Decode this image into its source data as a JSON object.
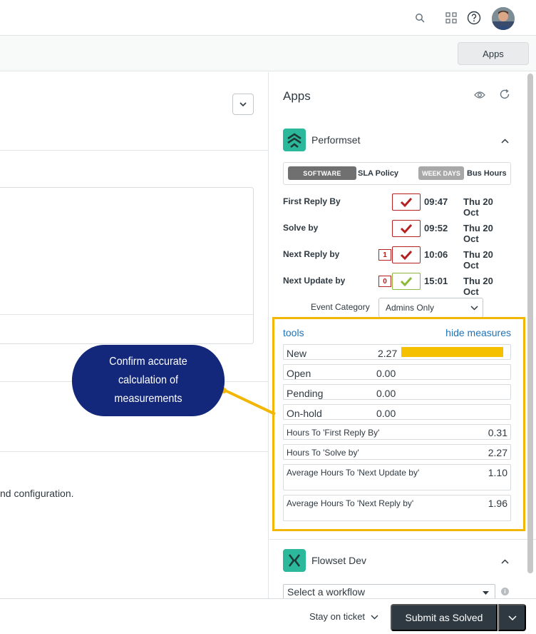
{
  "topbar": {
    "icons": [
      "search-icon",
      "apps-grid-icon",
      "help-icon"
    ],
    "user": "avatar"
  },
  "subbar": {
    "apps_button": "Apps"
  },
  "left": {
    "body_text": "nd configuration."
  },
  "apps_panel": {
    "title": "Apps",
    "icons": [
      "eye-icon",
      "refresh-icon"
    ],
    "performset": {
      "name": "Performset",
      "sla": {
        "software_tag": "SOFTWARE",
        "policy_label": "SLA Policy",
        "weekdays_tag": "WEEK DAYS",
        "hours_label": "Bus Hours"
      },
      "rows": [
        {
          "name": "First Reply By",
          "count": "",
          "status": "breached",
          "time": "09:47",
          "date": "Thu 20 Oct"
        },
        {
          "name": "Solve by",
          "count": "",
          "status": "breached",
          "time": "09:52",
          "date": "Thu 20 Oct"
        },
        {
          "name": "Next Reply by",
          "count": "1",
          "status": "breached",
          "time": "10:06",
          "date": "Thu 20 Oct"
        },
        {
          "name": "Next Update by",
          "count": "0",
          "status": "ok",
          "time": "15:01",
          "date": "Thu 20 Oct"
        }
      ],
      "event_category": {
        "label": "Event Category",
        "value": "Admins Only"
      },
      "measures": {
        "tools_link": "tools",
        "hide_link": "hide measures",
        "status_rows": [
          {
            "label": "New",
            "value": "2.27",
            "fill": 0.95
          },
          {
            "label": "Open",
            "value": "0.00",
            "fill": 0
          },
          {
            "label": "Pending",
            "value": "0.00",
            "fill": 0
          },
          {
            "label": "On-hold",
            "value": "0.00",
            "fill": 0
          }
        ],
        "hour_rows": [
          {
            "label": "Hours To 'First Reply By'",
            "value": "0.31"
          },
          {
            "label": "Hours To 'Solve by'",
            "value": "2.27"
          },
          {
            "label": "Average Hours To 'Next Update by'",
            "value": "1.10"
          },
          {
            "label": "Average Hours To 'Next Reply by'",
            "value": "1.96"
          }
        ]
      }
    },
    "flowset": {
      "name": "Flowset Dev",
      "workflow_select": "Select a workflow"
    }
  },
  "callout": {
    "text": "Confirm accurate calculation of measurements"
  },
  "bottombar": {
    "stay_label": "Stay on ticket",
    "submit_label": "Submit as Solved"
  },
  "colors": {
    "brand_teal": "#2bb89b",
    "callout_navy": "#13287a",
    "highlight_yellow": "#f2b705",
    "breach_red": "#b52020",
    "ok_green": "#8bb93b",
    "link_blue": "#1f73b7",
    "button_dark": "#2f3941"
  }
}
